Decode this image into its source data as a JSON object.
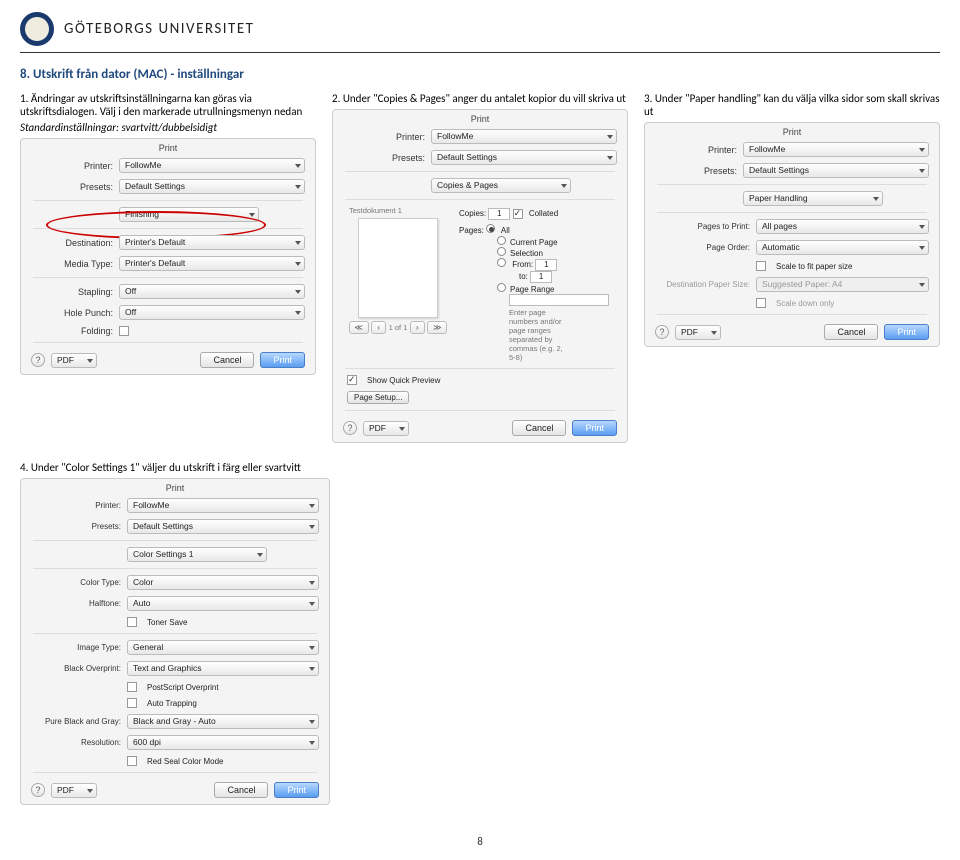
{
  "header": {
    "university": "GÖTEBORGS UNIVERSITET"
  },
  "section_title": "8. Utskrift från dator (MAC) - inställningar",
  "col1": {
    "line1": "1. Ändringar av utskriftsinställningarna kan göras via utskriftsdialogen. Välj i den markerade utrullningsmenyn nedan",
    "line2_italic": "Standardinställningar: svartvitt/dubbelsidigt"
  },
  "col2": {
    "text": "2. Under \"Copies & Pages\" anger du antalet kopior du vill skriva ut"
  },
  "col3": {
    "text": "3. Under \"Paper handling\" kan du välja vilka sidor som skall skrivas ut"
  },
  "section4": {
    "text": "4. Under \"Color Settings 1\" väljer du utskrift i färg eller svartvitt"
  },
  "dialog_common": {
    "title": "Print",
    "printer_label": "Printer:",
    "presets_label": "Presets:",
    "printer_value": "FollowMe",
    "presets_value": "Default Settings",
    "cancel": "Cancel",
    "print": "Print",
    "pdf": "PDF",
    "help": "?"
  },
  "dlg1": {
    "drop": "Finishing",
    "dest_label": "Destination:",
    "dest_value": "Printer's Default",
    "media_label": "Media Type:",
    "media_value": "Printer's Default",
    "stapling_label": "Stapling:",
    "stapling_value": "Off",
    "hole_label": "Hole Punch:",
    "hole_value": "Off",
    "folding_label": "Folding:"
  },
  "dlg2": {
    "drop": "Copies & Pages",
    "thumb_label": "Testdokument 1",
    "copies_label": "Copies:",
    "copies_value": "1",
    "collated": "Collated",
    "pages_label": "Pages:",
    "all": "All",
    "current": "Current Page",
    "selection": "Selection",
    "from": "From:",
    "from_val": "1",
    "to": "to:",
    "to_val": "1",
    "range": "Page Range",
    "range_hint": "Enter page numbers and/or page ranges separated by commas (e.g. 2, 5-8)",
    "nav_of": "1 of 1",
    "show_preview": "Show Quick Preview",
    "page_setup": "Page Setup..."
  },
  "dlg3": {
    "drop": "Paper Handling",
    "pages_to_print_label": "Pages to Print:",
    "pages_to_print_value": "All pages",
    "page_order_label": "Page Order:",
    "page_order_value": "Automatic",
    "scale_fit": "Scale to fit paper size",
    "dest_size_label": "Destination Paper Size:",
    "dest_size_value": "Suggested Paper: A4",
    "scale_down": "Scale down only"
  },
  "dlg4": {
    "drop": "Color Settings 1",
    "color_type_label": "Color Type:",
    "color_type_value": "Color",
    "halftone_label": "Halftone:",
    "halftone_value": "Auto",
    "toner_save": "Toner Save",
    "image_type_label": "Image Type:",
    "image_type_value": "General",
    "black_overprint_label": "Black Overprint:",
    "black_overprint_value": "Text and Graphics",
    "postscript": "PostScript Overprint",
    "auto_trapping": "Auto Trapping",
    "pure_bw_label": "Pure Black and Gray:",
    "pure_bw_value": "Black and Gray - Auto",
    "resolution_label": "Resolution:",
    "resolution_value": "600 dpi",
    "red_seal": "Red Seal Color Mode"
  },
  "page_number": "8"
}
